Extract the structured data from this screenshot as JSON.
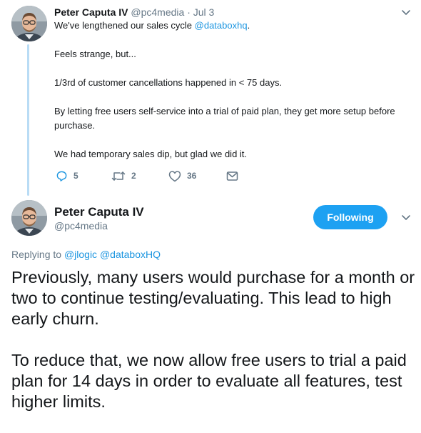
{
  "tweet1": {
    "author_name": "Peter Caputa IV",
    "author_handle": "@pc4media",
    "separator": "·",
    "date": "Jul 3",
    "text_line1_before": "We've lengthened our sales cycle ",
    "text_line1_mention": "@databoxhq",
    "text_line1_after": ".",
    "paragraphs": [
      "Feels strange, but...",
      "1/3rd of customer cancellations happened in < 75 days.",
      "By letting free users self-service into a trial of paid plan, they get more setup before purchase.",
      "We had temporary sales dip, but glad we did it."
    ],
    "replies_count": "5",
    "retweets_count": "2",
    "likes_count": "36",
    "icons": [
      "reply-icon",
      "retweet-icon",
      "like-icon",
      "message-icon",
      "chevron-down-icon"
    ]
  },
  "tweet2": {
    "author_name": "Peter Caputa IV",
    "author_handle": "@pc4media",
    "follow_button_label": "Following",
    "replying_to_label": "Replying to ",
    "replying_to_mentions": "@jlogic @databoxHQ",
    "paragraphs": [
      "Previously, many users would purchase for a month or two to continue testing/evaluating. This lead to high early churn.",
      "To reduce that, we now allow free users to trial a paid plan for 14 days in order to evaluate all features, test higher limits."
    ]
  },
  "colors": {
    "accent": "#1da1f2",
    "link": "#1b95e0",
    "muted": "#657786",
    "text": "#14171a",
    "thread_line": "#b9dcf5"
  }
}
